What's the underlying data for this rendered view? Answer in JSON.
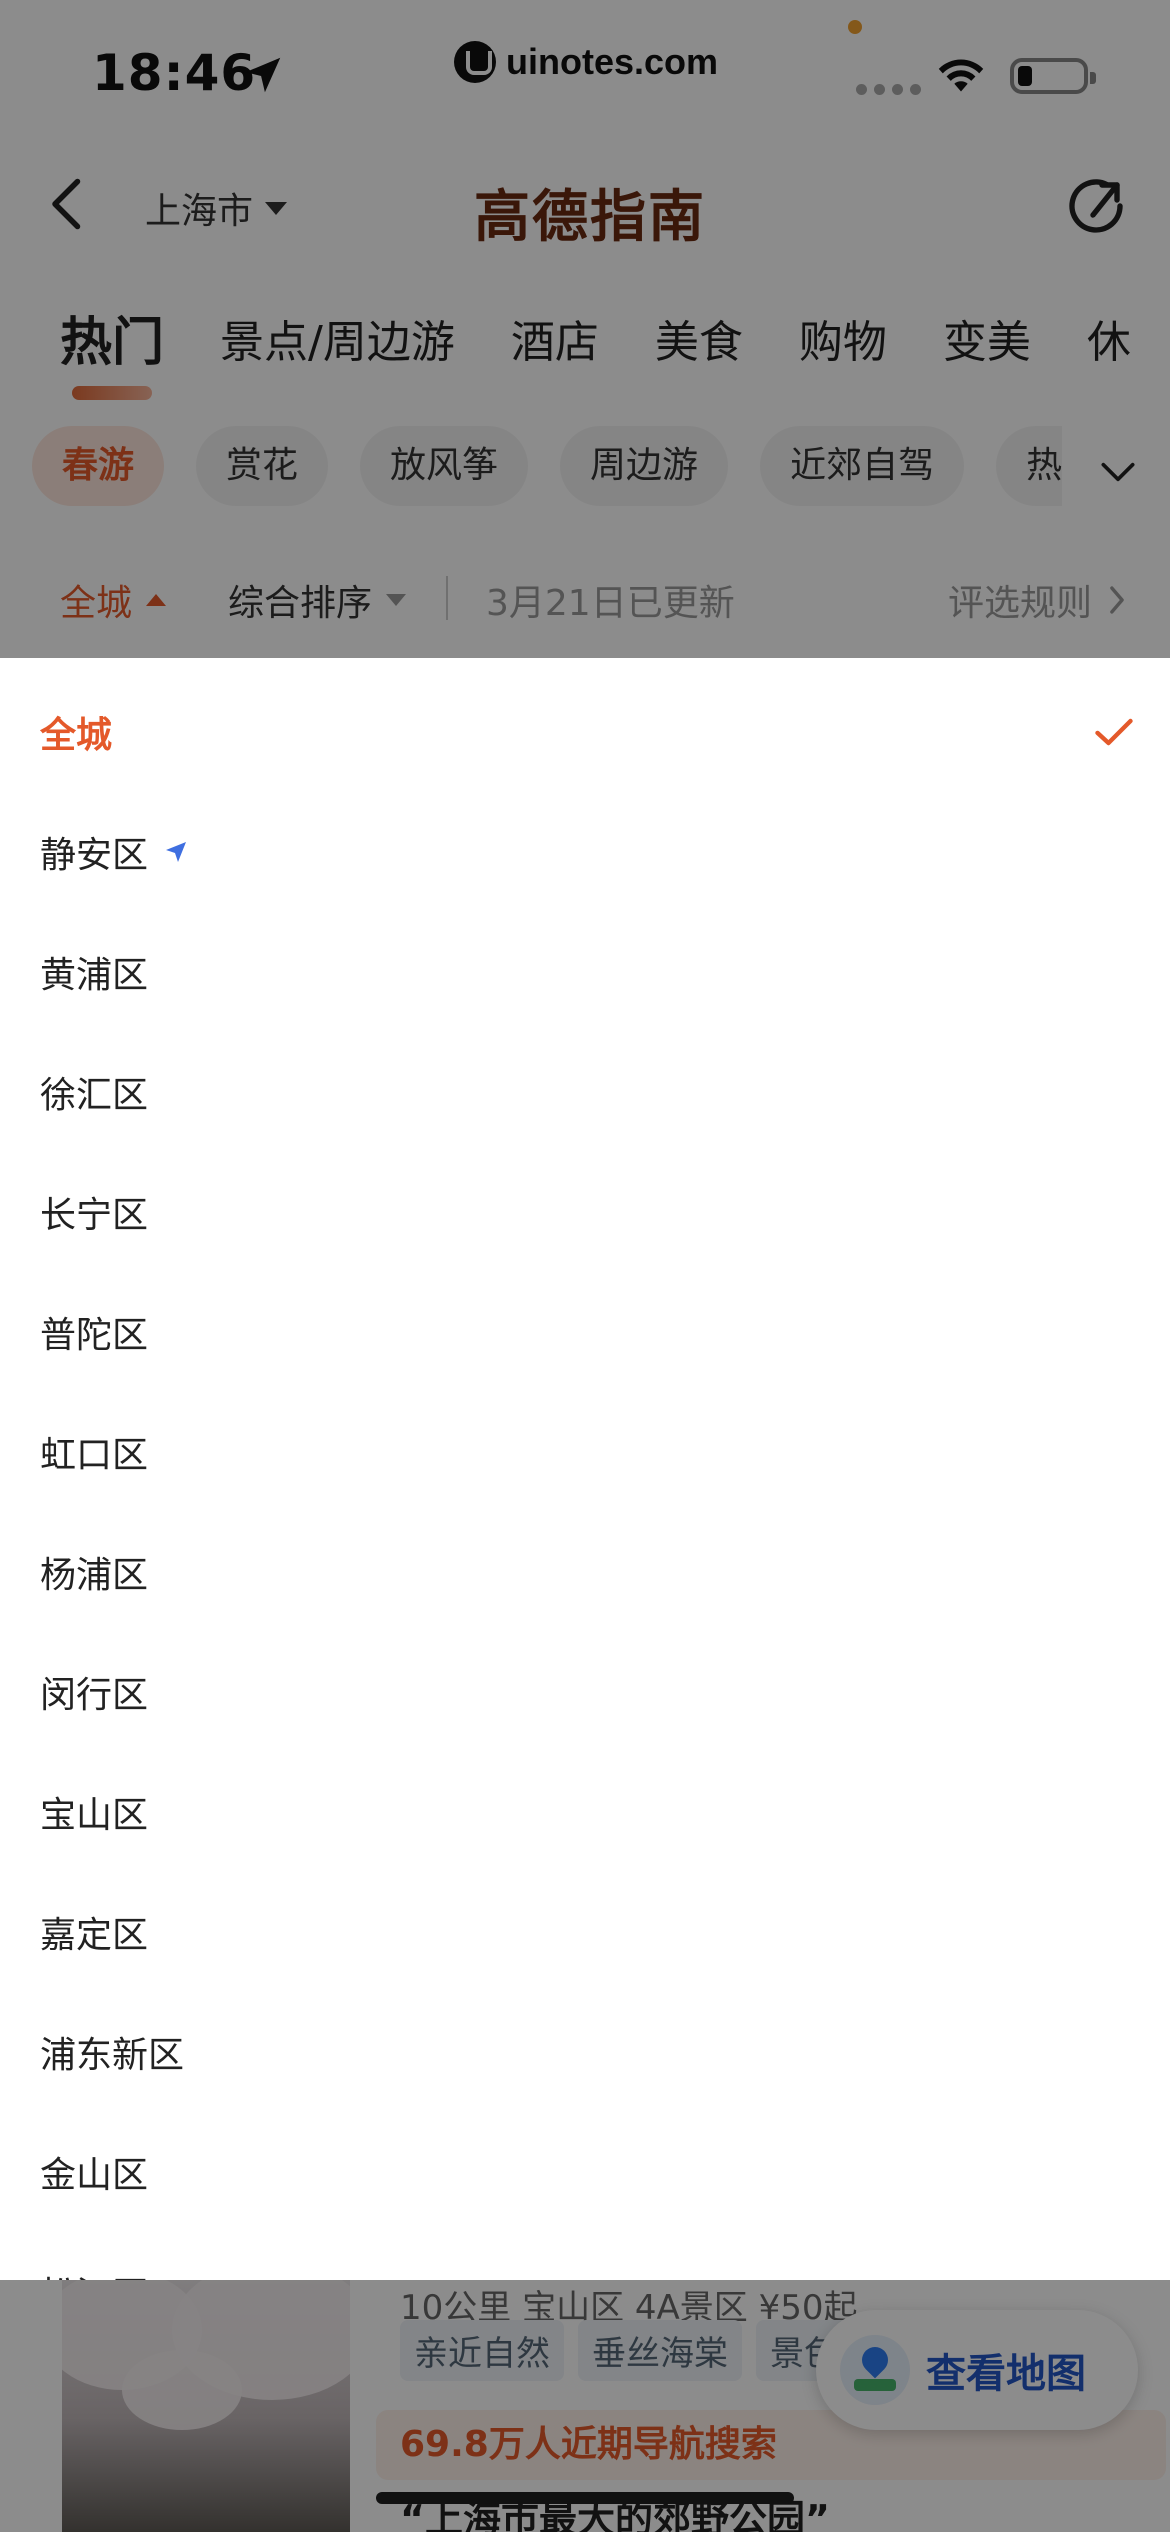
{
  "status_bar": {
    "time": "18:46",
    "watermark": "uinotes.com"
  },
  "nav": {
    "city": "上海市",
    "brand": "高德指南",
    "back_icon": "chevron-left-icon",
    "refresh_icon": "refresh-icon"
  },
  "category_tabs": [
    {
      "label": "热门",
      "active": true
    },
    {
      "label": "景点/周边游",
      "active": false
    },
    {
      "label": "酒店",
      "active": false
    },
    {
      "label": "美食",
      "active": false
    },
    {
      "label": "购物",
      "active": false
    },
    {
      "label": "变美",
      "active": false
    },
    {
      "label": "休",
      "active": false
    }
  ],
  "chips": [
    {
      "label": "春游",
      "active": true
    },
    {
      "label": "赏花",
      "active": false
    },
    {
      "label": "放风筝",
      "active": false
    },
    {
      "label": "周边游",
      "active": false
    },
    {
      "label": "近郊自驾",
      "active": false
    },
    {
      "label": "热门",
      "active": false
    }
  ],
  "filters": {
    "area": "全城",
    "sort": "综合排序",
    "updated": "3月21日已更新",
    "rules": "评选规则"
  },
  "district_options": [
    {
      "label": "全城",
      "selected": true
    },
    {
      "label": "静安区",
      "current_location": true
    },
    {
      "label": "黄浦区"
    },
    {
      "label": "徐汇区"
    },
    {
      "label": "长宁区"
    },
    {
      "label": "普陀区"
    },
    {
      "label": "虹口区"
    },
    {
      "label": "杨浦区"
    },
    {
      "label": "闵行区"
    },
    {
      "label": "宝山区"
    },
    {
      "label": "嘉定区"
    },
    {
      "label": "浦东新区"
    },
    {
      "label": "金山区"
    },
    {
      "label": "松江区"
    }
  ],
  "peek_card": {
    "meta": "10公里  宝山区  4A景区  ¥50起",
    "tags": [
      "亲近自然",
      "垂丝海棠",
      "景色"
    ],
    "stat": "69.8万人近期导航搜索",
    "quote": "“上海市最大的郊野公园”"
  },
  "map_button": {
    "label": "查看地图"
  },
  "colors": {
    "accent": "#e4592a",
    "brand": "#6b2a12",
    "map_blue": "#2457c5"
  }
}
